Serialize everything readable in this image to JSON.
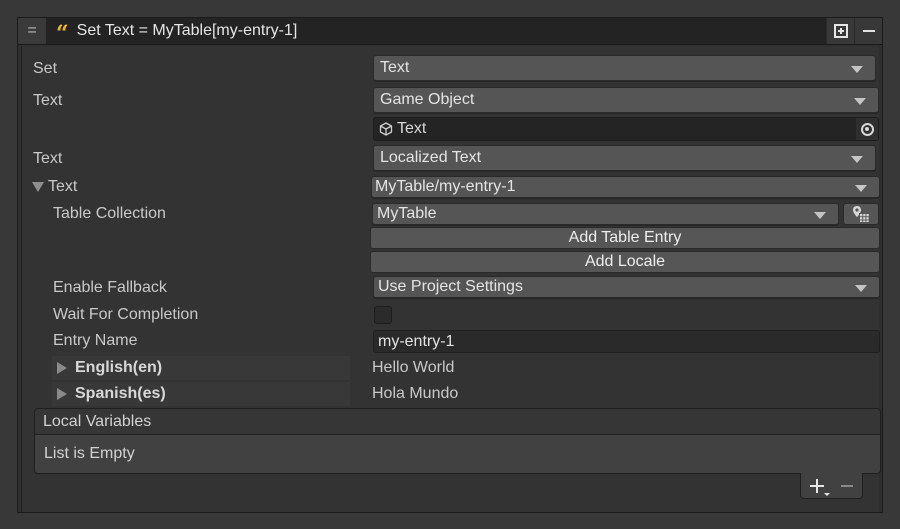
{
  "header": {
    "title": "Set Text = MyTable[my-entry-1]",
    "menu_icon": "hamburger-icon",
    "type_icon": "quote-icon",
    "expand_icon": "plus-box-icon",
    "collapse_icon": "minus-icon"
  },
  "fields": {
    "set": {
      "label": "Set",
      "value": "Text"
    },
    "text_source": {
      "label": "Text",
      "value": "Game Object"
    },
    "object_field": {
      "value": "Text",
      "icon": "cube-icon",
      "picker_icon": "object-picker-icon"
    },
    "text_type": {
      "label": "Text",
      "value": "Localized Text"
    },
    "text_foldout": {
      "label": "Text",
      "value": "MyTable/my-entry-1",
      "expanded": true
    },
    "table_collection": {
      "label": "Table Collection",
      "value": "MyTable",
      "icon": "localization-tables-icon"
    },
    "add_table_entry": {
      "label": "Add Table Entry"
    },
    "add_locale": {
      "label": "Add Locale"
    },
    "enable_fallback": {
      "label": "Enable Fallback",
      "value": "Use Project Settings"
    },
    "wait_for_completion": {
      "label": "Wait For Completion",
      "checked": false
    },
    "entry_name": {
      "label": "Entry Name",
      "value": "my-entry-1"
    }
  },
  "locales": [
    {
      "name": "English(en)",
      "value": "Hello World"
    },
    {
      "name": "Spanish(es)",
      "value": "Hola Mundo"
    }
  ],
  "local_variables": {
    "header": "Local Variables",
    "empty_text": "List is Empty",
    "add_icon": "add-dropdown-icon",
    "remove_icon": "remove-icon"
  }
}
